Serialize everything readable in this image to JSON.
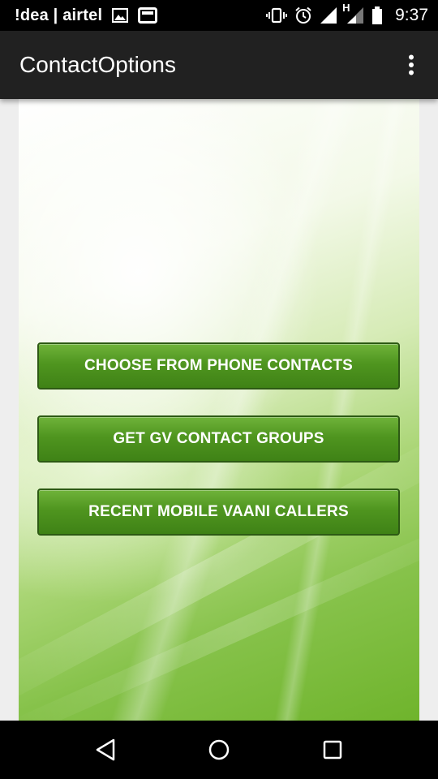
{
  "status_bar": {
    "carrier": "!dea | airtel",
    "time": "9:37",
    "network_type": "H",
    "icons": [
      "image-icon",
      "screen-icon",
      "vibrate-icon",
      "alarm-icon",
      "signal-icon",
      "signal-icon-2",
      "battery-icon"
    ]
  },
  "app_bar": {
    "title": "ContactOptions",
    "menu_icon": "overflow-menu-icon"
  },
  "main": {
    "buttons": [
      {
        "label": "CHOOSE FROM PHONE CONTACTS"
      },
      {
        "label": "GET GV CONTACT GROUPS"
      },
      {
        "label": "RECENT MOBILE VAANI CALLERS"
      }
    ]
  },
  "nav_bar": {
    "icons": [
      "back-icon",
      "home-icon",
      "recents-icon"
    ]
  },
  "colors": {
    "status_bar_bg": "#000000",
    "app_bar_bg": "#212121",
    "button_green": "#4f951f",
    "button_border": "#2d5a14"
  }
}
